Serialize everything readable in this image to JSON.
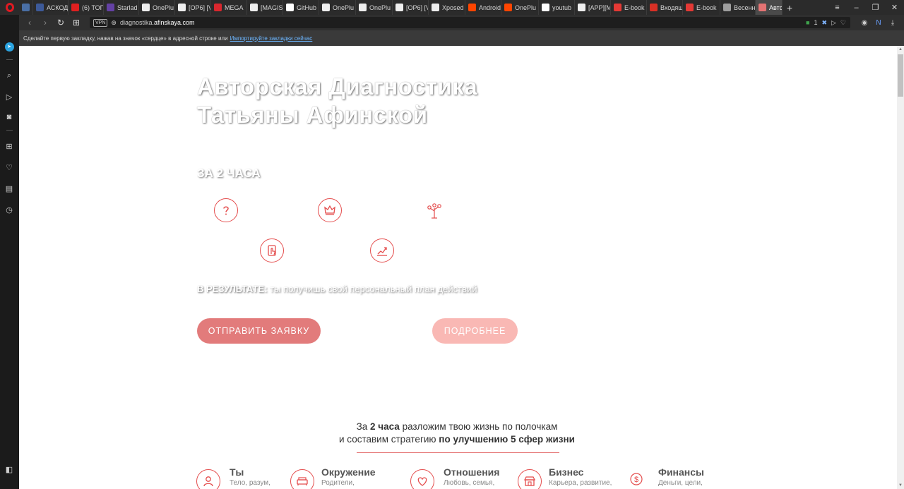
{
  "browser": {
    "tabs": [
      {
        "label": "",
        "icon": "extension-icon",
        "color": "#4a6fa5"
      },
      {
        "label": "АСКОД",
        "icon": "star-icon",
        "color": "#3d5a99"
      },
      {
        "label": "(6) ТОП",
        "icon": "youtube-icon",
        "color": "#e02020"
      },
      {
        "label": "Starlad",
        "icon": "twitch-icon",
        "color": "#6441a5"
      },
      {
        "label": "OnePlu",
        "icon": "page-icon",
        "color": "#eeeeee"
      },
      {
        "label": "[OP6] [V",
        "icon": "page-icon",
        "color": "#eeeeee"
      },
      {
        "label": "MEGA",
        "icon": "mega-icon",
        "color": "#d9272e"
      },
      {
        "label": "[MAGIS",
        "icon": "page-icon",
        "color": "#eeeeee"
      },
      {
        "label": "GitHub",
        "icon": "github-icon",
        "color": "#ffffff"
      },
      {
        "label": "OnePlu",
        "icon": "document-icon",
        "color": "#eeeeee"
      },
      {
        "label": "OnePlu",
        "icon": "page-icon",
        "color": "#eeeeee"
      },
      {
        "label": "[OP6] [V",
        "icon": "page-icon",
        "color": "#eeeeee"
      },
      {
        "label": "Xposed",
        "icon": "page-icon",
        "color": "#eeeeee"
      },
      {
        "label": "Android",
        "icon": "reddit-icon",
        "color": "#ff4500"
      },
      {
        "label": "OnePlu",
        "icon": "reddit-icon",
        "color": "#ff4500"
      },
      {
        "label": "youtub",
        "icon": "google-icon",
        "color": "#ffffff"
      },
      {
        "label": "[APP][M",
        "icon": "page-icon",
        "color": "#eeeeee"
      },
      {
        "label": "E-book",
        "icon": "t-icon",
        "color": "#e53935"
      },
      {
        "label": "Входящ",
        "icon": "mail-icon",
        "color": "#d93025"
      },
      {
        "label": "E-book",
        "icon": "t-icon",
        "color": "#e53935"
      },
      {
        "label": "Весенн",
        "icon": "t-circle-icon",
        "color": "#9e9e9e"
      },
      {
        "label": "Авто",
        "icon": "flower-icon",
        "color": "#e57373",
        "active": true
      }
    ],
    "url_prefix": "diagnostika.",
    "url_domain": "afinskaya.com",
    "vpn_label": "VPN",
    "extension_badge": "1",
    "bookmark_hint": "Сделайте первую закладку, нажав на значок «сердце» в адресной строке или",
    "bookmark_link": "Импортируйте закладки сейчас"
  },
  "hero": {
    "title_line1": "Авторская Диагностика",
    "title_line2": "Татьяны Афинской",
    "subtitle": "ЗА 2 ЧАСА",
    "feature_icons": [
      "question-icon",
      "crown-icon",
      "tree-icon",
      "touch-icon",
      "growth-chart-icon"
    ],
    "result_label": "В РЕЗУЛЬТАТЕ:",
    "result_text": " ты получишь свой персональный план действий",
    "primary_button": "ОТПРАВИТЬ ЗАЯВКУ",
    "secondary_button": "ПОДРОБНЕЕ"
  },
  "intro": {
    "line1_a": "За ",
    "line1_b": "2 часа",
    "line1_c": " разложим твою жизнь по полочкам",
    "line2_a": "и составим стратегию ",
    "line2_b": "по улучшению 5 сфер жизни"
  },
  "spheres": [
    {
      "title": "Ты",
      "desc": "Тело, разум,",
      "icon": "person-icon"
    },
    {
      "title": "Окружение",
      "desc": "Родители,",
      "icon": "sofa-icon"
    },
    {
      "title": "Отношения",
      "desc": "Любовь, семья,",
      "icon": "heart-icon"
    },
    {
      "title": "Бизнес",
      "desc": "Карьера, развитие,",
      "icon": "shop-icon"
    },
    {
      "title": "Финансы",
      "desc": "Деньги, цели,",
      "icon": "dollar-icon"
    }
  ],
  "colors": {
    "accent": "#e44c4c",
    "primary_button": "#e27b7b",
    "secondary_button": "#f9b8b4",
    "opera_red": "#e01a22"
  }
}
